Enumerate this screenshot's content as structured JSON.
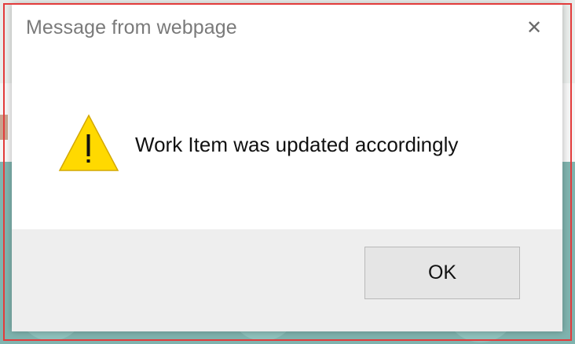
{
  "dialog": {
    "title": "Message from webpage",
    "close_icon": "close-icon",
    "message": "Work Item was updated accordingly",
    "warning_icon": "warning-icon",
    "ok_label": "OK"
  },
  "colors": {
    "warning_fill": "#ffd900",
    "warning_stroke": "#d3a800",
    "frame_highlight": "#e23b3b"
  }
}
